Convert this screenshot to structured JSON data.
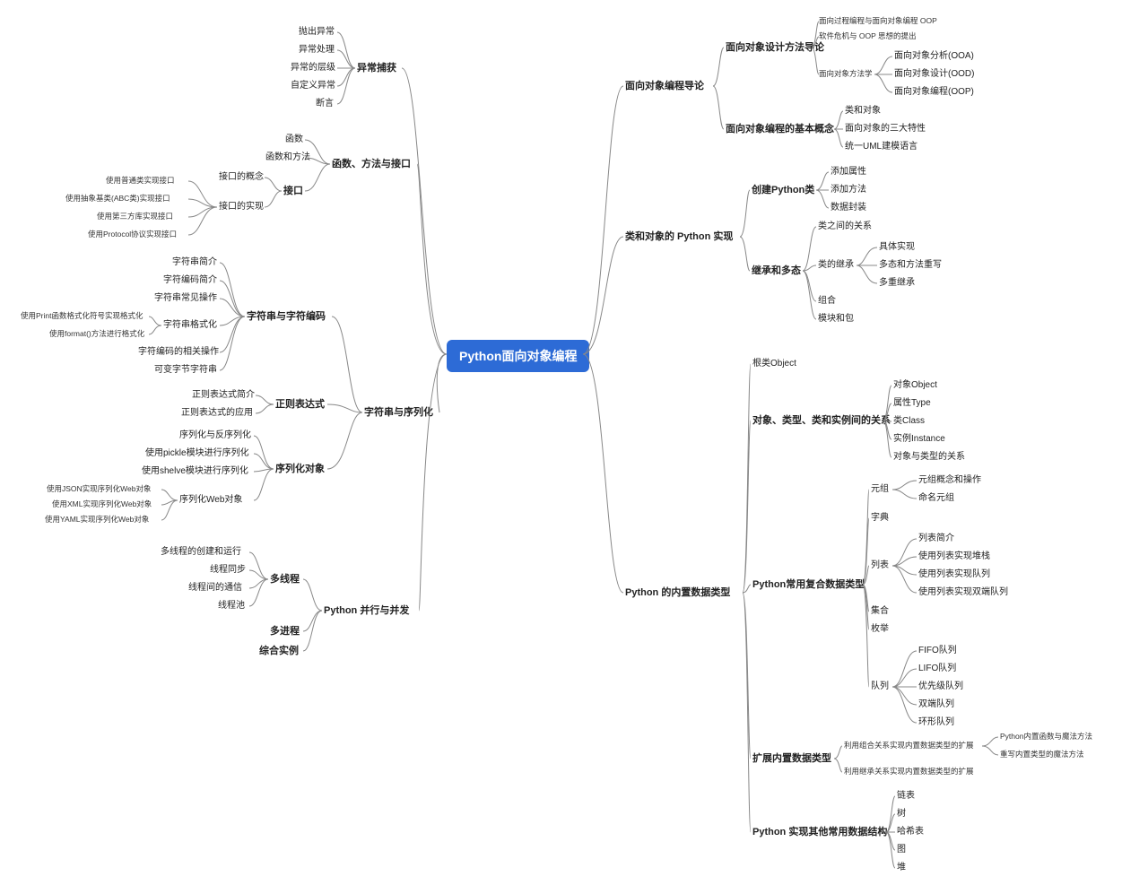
{
  "root": "Python面向对象编程",
  "left": {
    "n1": {
      "label": "异常捕获",
      "children": {
        "c1": "抛出异常",
        "c2": "异常处理",
        "c3": "异常的层级",
        "c4": "自定义异常",
        "c5": "断言"
      }
    },
    "n2": {
      "label": "函数、方法与接口",
      "children": {
        "c1": "函数",
        "c2": "函数和方法",
        "c3": {
          "label": "接口",
          "children": {
            "s1": "接口的概念",
            "s2": {
              "label": "接口的实现",
              "children": {
                "t1": "使用普通类实现接口",
                "t2": "使用抽象基类(ABC类)实现接口",
                "t3": "使用第三方库实现接口",
                "t4": "使用Protocol协议实现接口"
              }
            }
          }
        }
      }
    },
    "n3": {
      "label": "字符串与序列化",
      "children": {
        "c1": {
          "label": "字符串与字符编码",
          "children": {
            "s1": "字符串简介",
            "s2": "字符编码简介",
            "s3": "字符串常见操作",
            "s4": {
              "label": "字符串格式化",
              "children": {
                "t1": "使用Print函数格式化符号实现格式化",
                "t2": "使用format()方法进行格式化"
              }
            },
            "s5": "字符编码的相关操作",
            "s6": "可变字节字符串"
          }
        },
        "c2": {
          "label": "正则表达式",
          "children": {
            "s1": "正则表达式简介",
            "s2": "正则表达式的应用"
          }
        },
        "c3": {
          "label": "序列化对象",
          "children": {
            "s1": "序列化与反序列化",
            "s2": "使用pickle模块进行序列化",
            "s3": "使用shelve模块进行序列化",
            "s4": {
              "label": "序列化Web对象",
              "children": {
                "t1": "使用JSON实现序列化Web对象",
                "t2": "使用XML实现序列化Web对象",
                "t3": "使用YAML实现序列化Web对象"
              }
            }
          }
        }
      }
    },
    "n4": {
      "label": "Python 并行与并发",
      "children": {
        "c1": {
          "label": "多线程",
          "children": {
            "s1": "多线程的创建和运行",
            "s2": "线程同步",
            "s3": "线程间的通信",
            "s4": "线程池"
          }
        },
        "c2": "多进程",
        "c3": "综合实例"
      }
    }
  },
  "right": {
    "n1": {
      "label": "面向对象编程导论",
      "children": {
        "c1": {
          "label": "面向对象设计方法导论",
          "children": {
            "s1": "面向过程编程与面向对象编程 OOP",
            "s2": "软件危机与 OOP 思想的提出",
            "s3": {
              "label": "面向对象方法学",
              "children": {
                "t1": "面向对象分析(OOA)",
                "t2": "面向对象设计(OOD)",
                "t3": "面向对象编程(OOP)"
              }
            }
          }
        },
        "c2": {
          "label": "面向对象编程的基本概念",
          "children": {
            "s1": "类和对象",
            "s2": "面向对象的三大特性",
            "s3": "统一UML建模语言"
          }
        }
      }
    },
    "n2": {
      "label": "类和对象的 Python 实现",
      "children": {
        "c1": {
          "label": "创建Python类",
          "children": {
            "s1": "添加属性",
            "s2": "添加方法",
            "s3": "数据封装"
          }
        },
        "c2": {
          "label": "继承和多态",
          "children": {
            "s1": "类之间的关系",
            "s2": {
              "label": "类的继承",
              "children": {
                "t1": "具体实现",
                "t2": "多态和方法重写",
                "t3": "多重继承"
              }
            },
            "s3": "组合",
            "s4": "模块和包"
          }
        }
      }
    },
    "n3": {
      "label": "Python 的内置数据类型",
      "children": {
        "c1": "根类Object",
        "c2": {
          "label": "对象、类型、类和实例间的关系",
          "children": {
            "s1": "对象Object",
            "s2": "属性Type",
            "s3": "类Class",
            "s4": "实例Instance",
            "s5": "对象与类型的关系"
          }
        },
        "c3": {
          "label": "Python常用复合数据类型",
          "children": {
            "s1": {
              "label": "元组",
              "children": {
                "t1": "元组概念和操作",
                "t2": "命名元组"
              }
            },
            "s2": "字典",
            "s3": {
              "label": "列表",
              "children": {
                "t1": "列表简介",
                "t2": "使用列表实现堆栈",
                "t3": "使用列表实现队列",
                "t4": "使用列表实现双端队列"
              }
            },
            "s4": "集合",
            "s5": "枚举",
            "s6": {
              "label": "队列",
              "children": {
                "t1": "FIFO队列",
                "t2": "LIFO队列",
                "t3": "优先级队列",
                "t4": "双端队列",
                "t5": "环形队列"
              }
            }
          }
        },
        "c4": {
          "label": "扩展内置数据类型",
          "children": {
            "s1": {
              "label": "利用组合关系实现内置数据类型的扩展",
              "children": {
                "t1": "Python内置函数与魔法方法",
                "t2": "重写内置类型的魔法方法"
              }
            },
            "s2": "利用继承关系实现内置数据类型的扩展"
          }
        },
        "c5": {
          "label": "Python 实现其他常用数据结构",
          "children": {
            "s1": "链表",
            "s2": "树",
            "s3": "哈希表",
            "s4": "图",
            "s5": "堆"
          }
        }
      }
    }
  }
}
